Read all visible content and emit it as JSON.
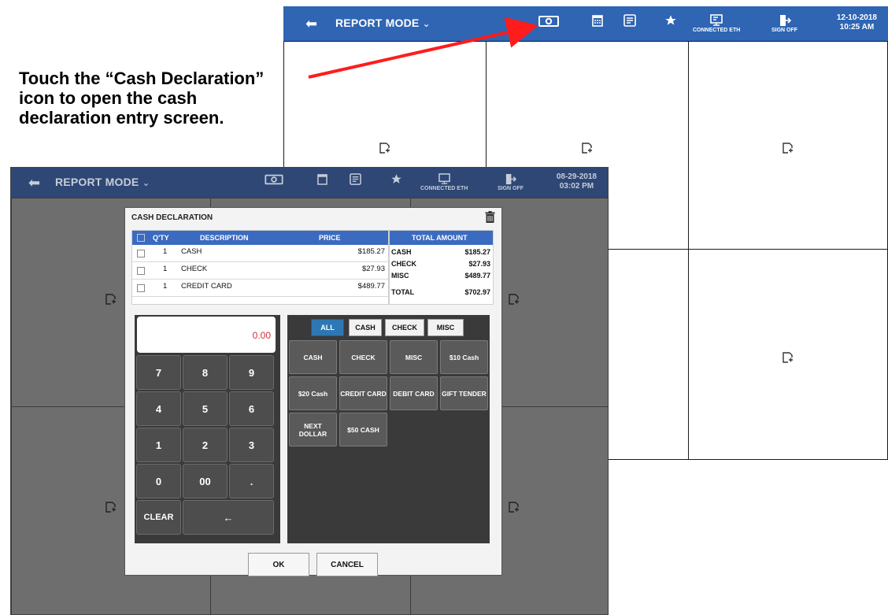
{
  "annotation": {
    "lines": [
      "Touch the “Cash Declaration”",
      "icon to open the cash",
      "declaration entry screen."
    ],
    "arrow_color": "#ff1c1c"
  },
  "back_screen": {
    "mode_label": "REPORT MODE",
    "chevron": "⌄",
    "back_arrow": "⬅",
    "icons": [
      "cash-declaration-icon",
      "calendar-icon",
      "report-icon",
      "star-icon",
      "connected-eth-icon",
      "sign-off-icon"
    ],
    "connected_label": "CONNECTED ETH",
    "sign_off_label": "SIGN OFF",
    "date": "12-10-2018",
    "time": "10:25 AM",
    "bar_color": "#2f65b3"
  },
  "front_screen": {
    "mode_label": "REPORT MODE",
    "chevron": "⌄",
    "back_arrow": "⬅",
    "connected_label": "CONNECTED ETH",
    "sign_off_label": "SIGN OFF",
    "date": "08-29-2018",
    "time": "03:02 PM"
  },
  "dialog": {
    "title": "CASH DECLARATION",
    "columns": {
      "qty": "Q'TY",
      "description": "DESCRIPTION",
      "price": "PRICE",
      "total_amount": "TOTAL AMOUNT"
    },
    "rows": [
      {
        "qty": "1",
        "description": "CASH",
        "price": "$185.27"
      },
      {
        "qty": "1",
        "description": "CHECK",
        "price": "$27.93"
      },
      {
        "qty": "1",
        "description": "CREDIT CARD",
        "price": "$489.77"
      }
    ],
    "totals": [
      {
        "label": "CASH",
        "amount": "$185.27"
      },
      {
        "label": "CHECK",
        "amount": "$27.93"
      },
      {
        "label": "MISC",
        "amount": "$489.77"
      },
      {
        "label": "TOTAL",
        "amount": "$702.97"
      }
    ],
    "display_value": "0.00",
    "keys": {
      "k7": "7",
      "k8": "8",
      "k9": "9",
      "k4": "4",
      "k5": "5",
      "k6": "6",
      "k1": "1",
      "k2": "2",
      "k3": "3",
      "k0": "0",
      "k00": "00",
      "kdot": ".",
      "clear": "CLEAR",
      "backspace": "←"
    },
    "filter_tabs": [
      "ALL",
      "CASH",
      "CHECK",
      "MISC"
    ],
    "tender_buttons": [
      "CASH",
      "CHECK",
      "MISC",
      "$10 Cash",
      "$20 Cash",
      "CREDIT CARD",
      "DEBIT CARD",
      "GIFT TENDER",
      "NEXT DOLLAR",
      "$50 CASH"
    ],
    "ok_label": "OK",
    "cancel_label": "CANCEL"
  }
}
